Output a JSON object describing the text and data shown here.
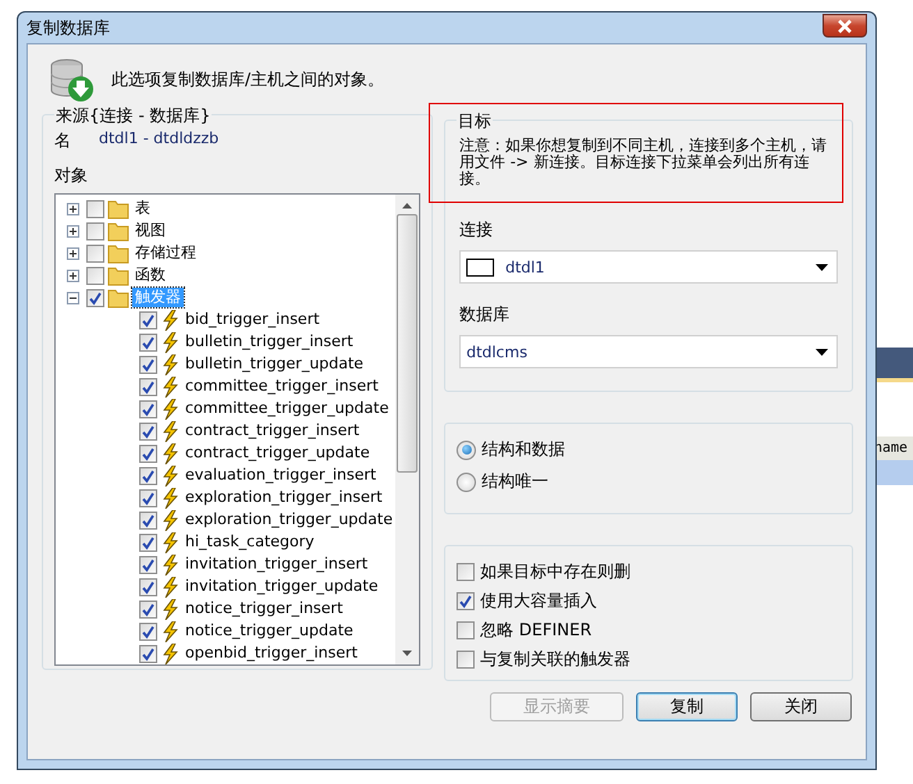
{
  "background_app": {
    "column_header": "name"
  },
  "window": {
    "title": "复制数据库"
  },
  "intro": "此选项复制数据库/主机之间的对象。",
  "source": {
    "legend": "来源{连接 - 数据库}",
    "name_label": "名",
    "name_value": "dtdl1 - dtdldzzb",
    "objects_label": "对象",
    "tree": [
      {
        "kind": "folder",
        "label": "表",
        "checked": false,
        "expanded": false,
        "selected": false
      },
      {
        "kind": "folder",
        "label": "视图",
        "checked": false,
        "expanded": false,
        "selected": false
      },
      {
        "kind": "folder",
        "label": "存储过程",
        "checked": false,
        "expanded": false,
        "selected": false
      },
      {
        "kind": "folder",
        "label": "函数",
        "checked": false,
        "expanded": false,
        "selected": false
      },
      {
        "kind": "folder",
        "label": "触发器",
        "checked": true,
        "expanded": true,
        "selected": true,
        "children": [
          {
            "kind": "trigger",
            "label": "bid_trigger_insert",
            "checked": true,
            "selected": false
          },
          {
            "kind": "trigger",
            "label": "bulletin_trigger_insert",
            "checked": true,
            "selected": false
          },
          {
            "kind": "trigger",
            "label": "bulletin_trigger_update",
            "checked": true,
            "selected": false
          },
          {
            "kind": "trigger",
            "label": "committee_trigger_insert",
            "checked": true,
            "selected": false
          },
          {
            "kind": "trigger",
            "label": "committee_trigger_update",
            "checked": true,
            "selected": false
          },
          {
            "kind": "trigger",
            "label": "contract_trigger_insert",
            "checked": true,
            "selected": false
          },
          {
            "kind": "trigger",
            "label": "contract_trigger_update",
            "checked": true,
            "selected": false
          },
          {
            "kind": "trigger",
            "label": "evaluation_trigger_insert",
            "checked": true,
            "selected": false
          },
          {
            "kind": "trigger",
            "label": "exploration_trigger_insert",
            "checked": true,
            "selected": false
          },
          {
            "kind": "trigger",
            "label": "exploration_trigger_update",
            "checked": true,
            "selected": false
          },
          {
            "kind": "trigger",
            "label": "hi_task_category",
            "checked": true,
            "selected": false
          },
          {
            "kind": "trigger",
            "label": "invitation_trigger_insert",
            "checked": true,
            "selected": false
          },
          {
            "kind": "trigger",
            "label": "invitation_trigger_update",
            "checked": true,
            "selected": false
          },
          {
            "kind": "trigger",
            "label": "notice_trigger_insert",
            "checked": true,
            "selected": false
          },
          {
            "kind": "trigger",
            "label": "notice_trigger_update",
            "checked": true,
            "selected": false
          },
          {
            "kind": "trigger",
            "label": "openbid_trigger_insert",
            "checked": true,
            "selected": false
          }
        ]
      }
    ]
  },
  "target": {
    "legend": "目标",
    "note": "注意：如果你想复制到不同主机，连接到多个主机，请用文件 -> 新连接。目标连接下拉菜单会列出所有连接。",
    "connection_label": "连接",
    "connection_value": "dtdl1",
    "database_label": "数据库",
    "database_value": "dtdlcms"
  },
  "copy_mode": [
    {
      "label": "结构和数据",
      "selected": true
    },
    {
      "label": "结构唯一",
      "selected": false
    }
  ],
  "options": [
    {
      "label": "如果目标中存在则删",
      "checked": false
    },
    {
      "label": "使用大容量插入",
      "checked": true
    },
    {
      "label": "忽略 DEFINER",
      "checked": false
    },
    {
      "label": "与复制关联的触发器",
      "checked": false
    }
  ],
  "buttons": [
    {
      "label": "显示摘要",
      "disabled": true,
      "default": false
    },
    {
      "label": "复制",
      "disabled": false,
      "default": true
    },
    {
      "label": "关闭",
      "disabled": false,
      "default": false
    }
  ]
}
